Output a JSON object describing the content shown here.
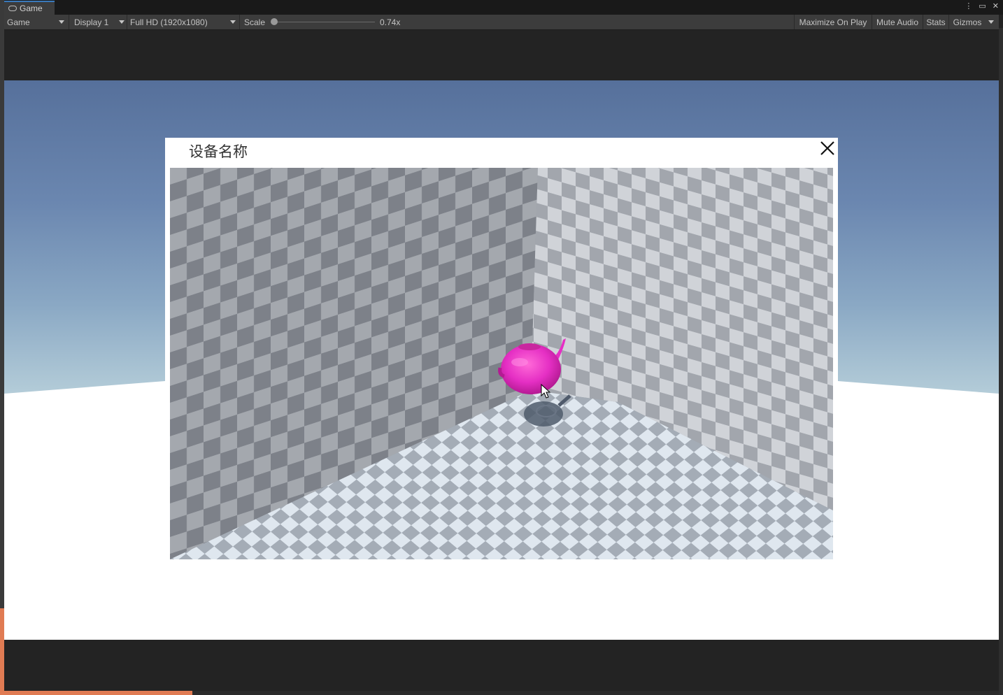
{
  "tab": {
    "title": "Game",
    "icon": "gamepad-icon"
  },
  "window_controls": {
    "more": "⋮",
    "maximize": "▭",
    "close": "✕"
  },
  "toolbar": {
    "view_mode": "Game",
    "display": "Display 1",
    "resolution": "Full HD (1920x1080)",
    "scale_label": "Scale",
    "scale_value": "0.74x",
    "scale_level": 0.0,
    "maximize_on_play": "Maximize On Play",
    "mute_audio": "Mute Audio",
    "stats": "Stats",
    "gizmos": "Gizmos"
  },
  "dialog": {
    "title": "设备名称",
    "close_icon": "close-icon"
  },
  "colors": {
    "teapot": "#e52fc4",
    "accent": "#3a79bb"
  }
}
